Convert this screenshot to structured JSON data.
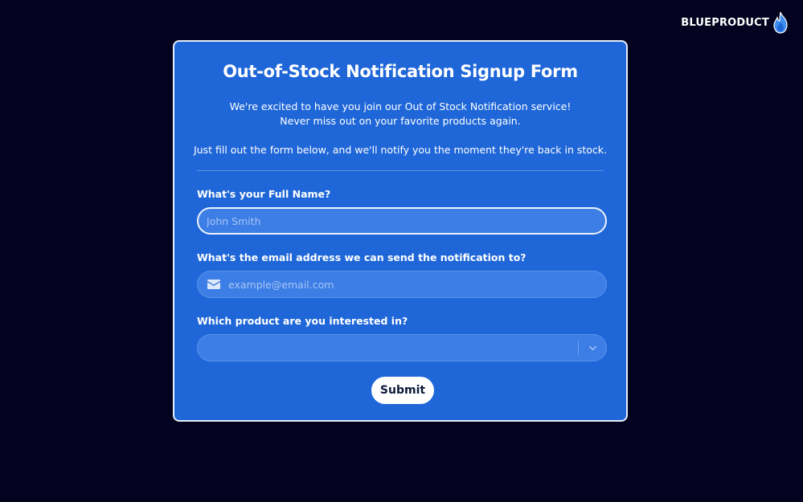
{
  "brand": {
    "name": "BLUEPRODUCT",
    "icon": "flame-icon"
  },
  "form": {
    "title": "Out-of-Stock Notification Signup Form",
    "intro": {
      "line1": "We're excited to have you join our Out of Stock Notification service!",
      "line2": "Never miss out on your favorite products again.",
      "line3": "Just fill out the form below, and we'll notify you the moment they're back in stock."
    },
    "full_name": {
      "label": "What's your Full Name?",
      "placeholder": "John Smith",
      "value": ""
    },
    "email": {
      "label": "What's the email address we can send the notification to?",
      "placeholder": "example@email.com",
      "value": "",
      "icon": "envelope-icon"
    },
    "product": {
      "label": "Which product are you interested in?",
      "selected": "",
      "icon": "chevron-down-icon"
    },
    "submit_label": "Submit"
  },
  "colors": {
    "page_background": "#04031f",
    "card_background": "#1f67d8",
    "field_background": "#3c7de6",
    "brand_flame": "#3d8ef0"
  }
}
